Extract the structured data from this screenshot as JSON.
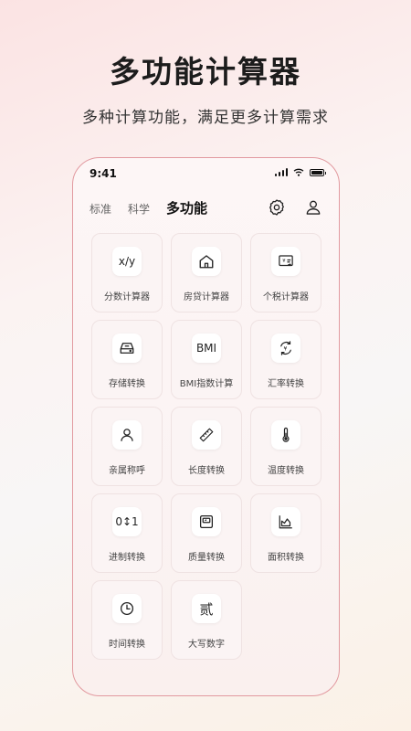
{
  "hero": {
    "title": "多功能计算器",
    "subtitle": "多种计算功能，满足更多计算需求"
  },
  "status_bar": {
    "time": "9:41"
  },
  "tabs": [
    {
      "label": "标准",
      "active": false
    },
    {
      "label": "科学",
      "active": false
    },
    {
      "label": "多功能",
      "active": true
    }
  ],
  "top_actions": [
    {
      "icon": "gear-icon"
    },
    {
      "icon": "user-icon"
    }
  ],
  "tools": [
    {
      "label": "分数计算器",
      "icon": "fraction-icon",
      "icon_text": "x/y"
    },
    {
      "label": "房贷计算器",
      "icon": "house-icon"
    },
    {
      "label": "个税计算器",
      "icon": "tax-icon"
    },
    {
      "label": "存储转换",
      "icon": "storage-icon"
    },
    {
      "label": "BMI指数计算",
      "icon": "bmi-icon",
      "icon_text": "BMI"
    },
    {
      "label": "汇率转换",
      "icon": "exchange-icon"
    },
    {
      "label": "亲属称呼",
      "icon": "person-icon"
    },
    {
      "label": "长度转换",
      "icon": "ruler-icon"
    },
    {
      "label": "温度转换",
      "icon": "thermometer-icon"
    },
    {
      "label": "进制转换",
      "icon": "binary-icon",
      "icon_text": "0↕1"
    },
    {
      "label": "质量转换",
      "icon": "scale-icon"
    },
    {
      "label": "面积转换",
      "icon": "area-chart-icon"
    },
    {
      "label": "时间转换",
      "icon": "clock-icon"
    },
    {
      "label": "大写数字",
      "icon": "uppercase-number-icon",
      "icon_text": "贰"
    }
  ]
}
